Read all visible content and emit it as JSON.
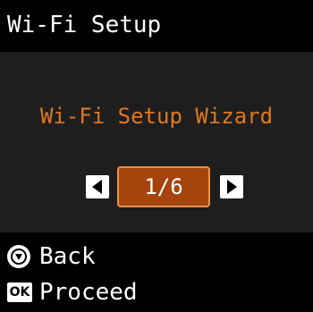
{
  "header": {
    "title": "Wi-Fi Setup"
  },
  "main": {
    "wizard_label": "Wi-Fi Setup Wizard",
    "pager": {
      "page": "1/6",
      "left_icon": "triangle-left-icon",
      "right_icon": "triangle-right-icon"
    }
  },
  "footer": {
    "back": {
      "icon": "stop-icon",
      "label": "Back"
    },
    "ok": {
      "icon_text": "OK",
      "label": "Proceed"
    }
  },
  "colors": {
    "background": "#000000",
    "panel": "#1e1e1e",
    "accent_text": "#e07820",
    "selected_fill": "#a6440e",
    "selected_border": "#e8944a",
    "text": "#ffffff"
  }
}
